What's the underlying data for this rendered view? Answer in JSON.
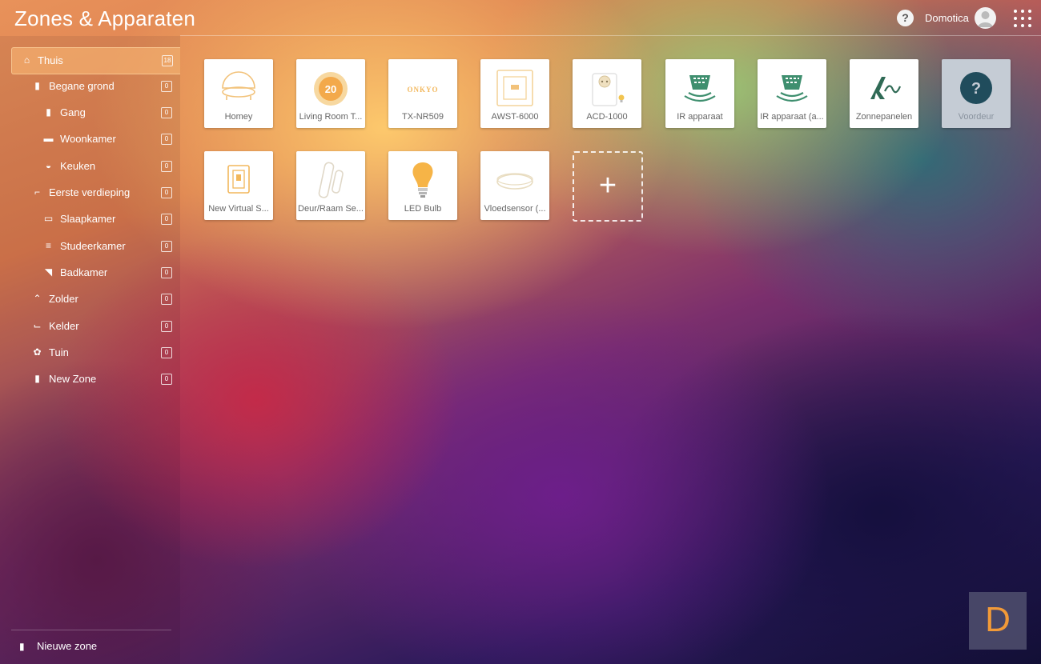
{
  "app": {
    "title": "Zones & Apparaten"
  },
  "header": {
    "help_label": "?",
    "user_name": "Domotica"
  },
  "sidebar": {
    "zones": [
      {
        "label": "Thuis",
        "count": "18",
        "icon": "home-icon",
        "active": true
      },
      {
        "label": "Begane grond",
        "count": "0",
        "icon": "door-icon"
      },
      {
        "label": "Gang",
        "count": "0",
        "icon": "door-icon"
      },
      {
        "label": "Woonkamer",
        "count": "0",
        "icon": "sofa-icon"
      },
      {
        "label": "Keuken",
        "count": "0",
        "icon": "pot-icon"
      },
      {
        "label": "Eerste verdieping",
        "count": "0",
        "icon": "stairs-icon"
      },
      {
        "label": "Slaapkamer",
        "count": "0",
        "icon": "bed-icon"
      },
      {
        "label": "Studeerkamer",
        "count": "0",
        "icon": "books-icon"
      },
      {
        "label": "Badkamer",
        "count": "0",
        "icon": "shower-icon"
      },
      {
        "label": "Zolder",
        "count": "0",
        "icon": "roof-icon"
      },
      {
        "label": "Kelder",
        "count": "0",
        "icon": "stairs-down-icon"
      },
      {
        "label": "Tuin",
        "count": "0",
        "icon": "flower-icon"
      },
      {
        "label": "New Zone",
        "count": "0",
        "icon": "door-icon"
      }
    ],
    "new_zone_label": "Nieuwe zone"
  },
  "devices": [
    {
      "label": "Homey",
      "icon": "homey-icon"
    },
    {
      "label": "Living Room T...",
      "icon": "thermostat-icon",
      "display": "20"
    },
    {
      "label": "TX-NR509",
      "icon": "onkyo-logo-icon",
      "display": "ONKYO"
    },
    {
      "label": "AWST-6000",
      "icon": "wall-switch-icon"
    },
    {
      "label": "ACD-1000",
      "icon": "plug-icon"
    },
    {
      "label": "IR apparaat",
      "icon": "ir-remote-icon"
    },
    {
      "label": "IR apparaat (a...",
      "icon": "ir-remote-icon"
    },
    {
      "label": "Zonnepanelen",
      "icon": "solar-icon"
    },
    {
      "label": "Voordeur",
      "icon": "unknown-device-icon",
      "display": "?",
      "offline": true
    },
    {
      "label": "New Virtual S...",
      "icon": "virtual-switch-icon"
    },
    {
      "label": "Deur/Raam Se...",
      "icon": "door-sensor-icon"
    },
    {
      "label": "LED Bulb",
      "icon": "bulb-icon"
    },
    {
      "label": "Vloedsensor (...",
      "icon": "flood-sensor-icon"
    }
  ],
  "add_device": {
    "label": "+"
  },
  "brand": {
    "letter": "D"
  },
  "colors": {
    "accent": "#f2b75c",
    "icon_green": "#3f8f6f",
    "icon_dark": "#204c5c",
    "badge": "#f29a38"
  }
}
